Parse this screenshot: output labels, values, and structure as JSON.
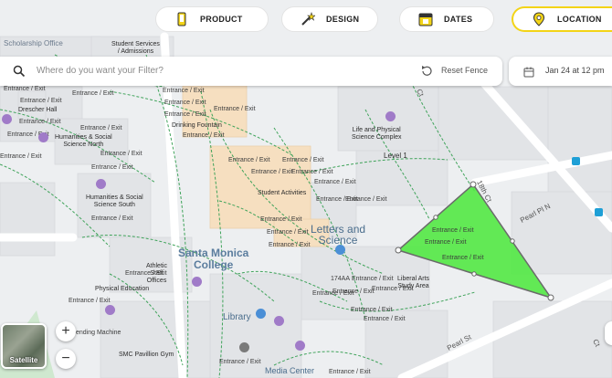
{
  "tabs": [
    {
      "label": "PRODUCT",
      "icon": "phone-icon"
    },
    {
      "label": "DESIGN",
      "icon": "magic-wand-icon"
    },
    {
      "label": "DATES",
      "icon": "calendar-icon"
    },
    {
      "label": "LOCATION",
      "icon": "location-pin-icon",
      "active": true
    }
  ],
  "search": {
    "placeholder": "Where do you want your Filter?",
    "reset_label": "Reset Fence"
  },
  "date": {
    "label": "Jan 24 at 12 pm"
  },
  "map": {
    "college_name_1": "Santa Monica",
    "college_name_2": "College",
    "letters_1": "Letters and",
    "letters_2": "Science",
    "entrance": "Entrance / Exit",
    "scholarship": "Scholarship Office",
    "student_services_1": "Student Services",
    "student_services_2": "/ Admissions",
    "drescher": "Drescher Hall",
    "hss_north_1": "Humanities & Social",
    "hss_north_2": "Science North",
    "hss_south_1": "Humanities & Social",
    "hss_south_2": "Science South",
    "drinking_fountain": "Drinking Fountain",
    "life_physical_1": "Life and Physical",
    "life_physical_2": "Science Complex",
    "level1": "Level 1",
    "student_activities": "Student Activities",
    "liberal_arts_1": "Liberal Arts",
    "liberal_arts_2": "Study Area",
    "room_174aa": "174AA",
    "athletic_1": "Athletic",
    "athletic_2": "Staff",
    "athletic_3": "Offices",
    "phys_ed": "Physical Education",
    "vending": "ending Machine",
    "smc_pavilion": "SMC Pavillion Gym",
    "library": "Library",
    "media_center": "Media Center",
    "street_18th": "18th Ct",
    "street_pearl_pl": "Pearl Pl N",
    "street_pearl_st": "Pearl St",
    "street_ct_top": "Ct",
    "street_edge": "Ct"
  },
  "map_controls": {
    "satellite_label": "Satellite",
    "zoom_in": "+",
    "zoom_out": "−"
  },
  "colors": {
    "fence_fill": "#52e844",
    "active_tab_border": "#f3d417",
    "path_green": "#3fa35a",
    "building_orange": "#f6dfc0"
  }
}
